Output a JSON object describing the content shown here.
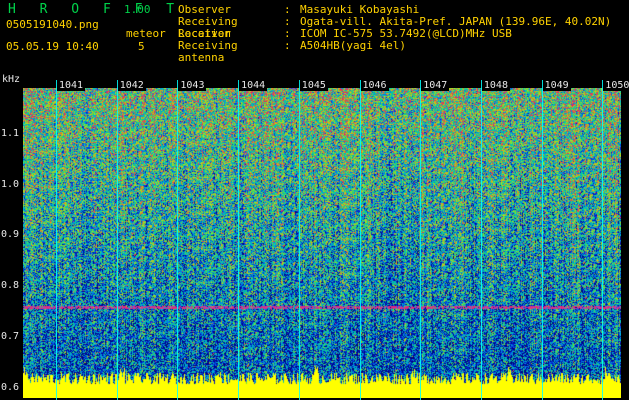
{
  "app": {
    "name": "H R O F F T",
    "version": "1.00"
  },
  "file": {
    "name": "0505191040.png",
    "datetime": "05.05.19 10:40"
  },
  "meteor": {
    "label": "meteor",
    "count": "5"
  },
  "info": [
    {
      "key": "Observer",
      "value": "Masayuki Kobayashi"
    },
    {
      "key": "Receiving Location",
      "value": "Ogata-vill. Akita-Pref. JAPAN (139.96E, 40.02N)"
    },
    {
      "key": "Receiver",
      "value": "ICOM IC-575 53.7492(@LCD)MHz USB"
    },
    {
      "key": "Receiving antenna",
      "value": "A504HB(yagi 4el)"
    }
  ],
  "yaxis": {
    "unit": "kHz",
    "ticks": [
      "1.1",
      "1.0",
      "0.9",
      "0.8",
      "0.7",
      "0.6"
    ],
    "values": [
      1.1,
      1.0,
      0.9,
      0.8,
      0.7,
      0.6
    ],
    "range": [
      0.58,
      1.19
    ]
  },
  "xaxis": {
    "ticks": [
      "1041",
      "1042",
      "1043",
      "1044",
      "1045",
      "1046",
      "1047",
      "1048",
      "1049",
      "1050"
    ]
  },
  "colors": {
    "logo": "#00d24a",
    "text": "#ffd200",
    "grid": "#00ffff",
    "baseline": "#ffff00"
  },
  "signal": {
    "carrier_khz": 0.76
  }
}
